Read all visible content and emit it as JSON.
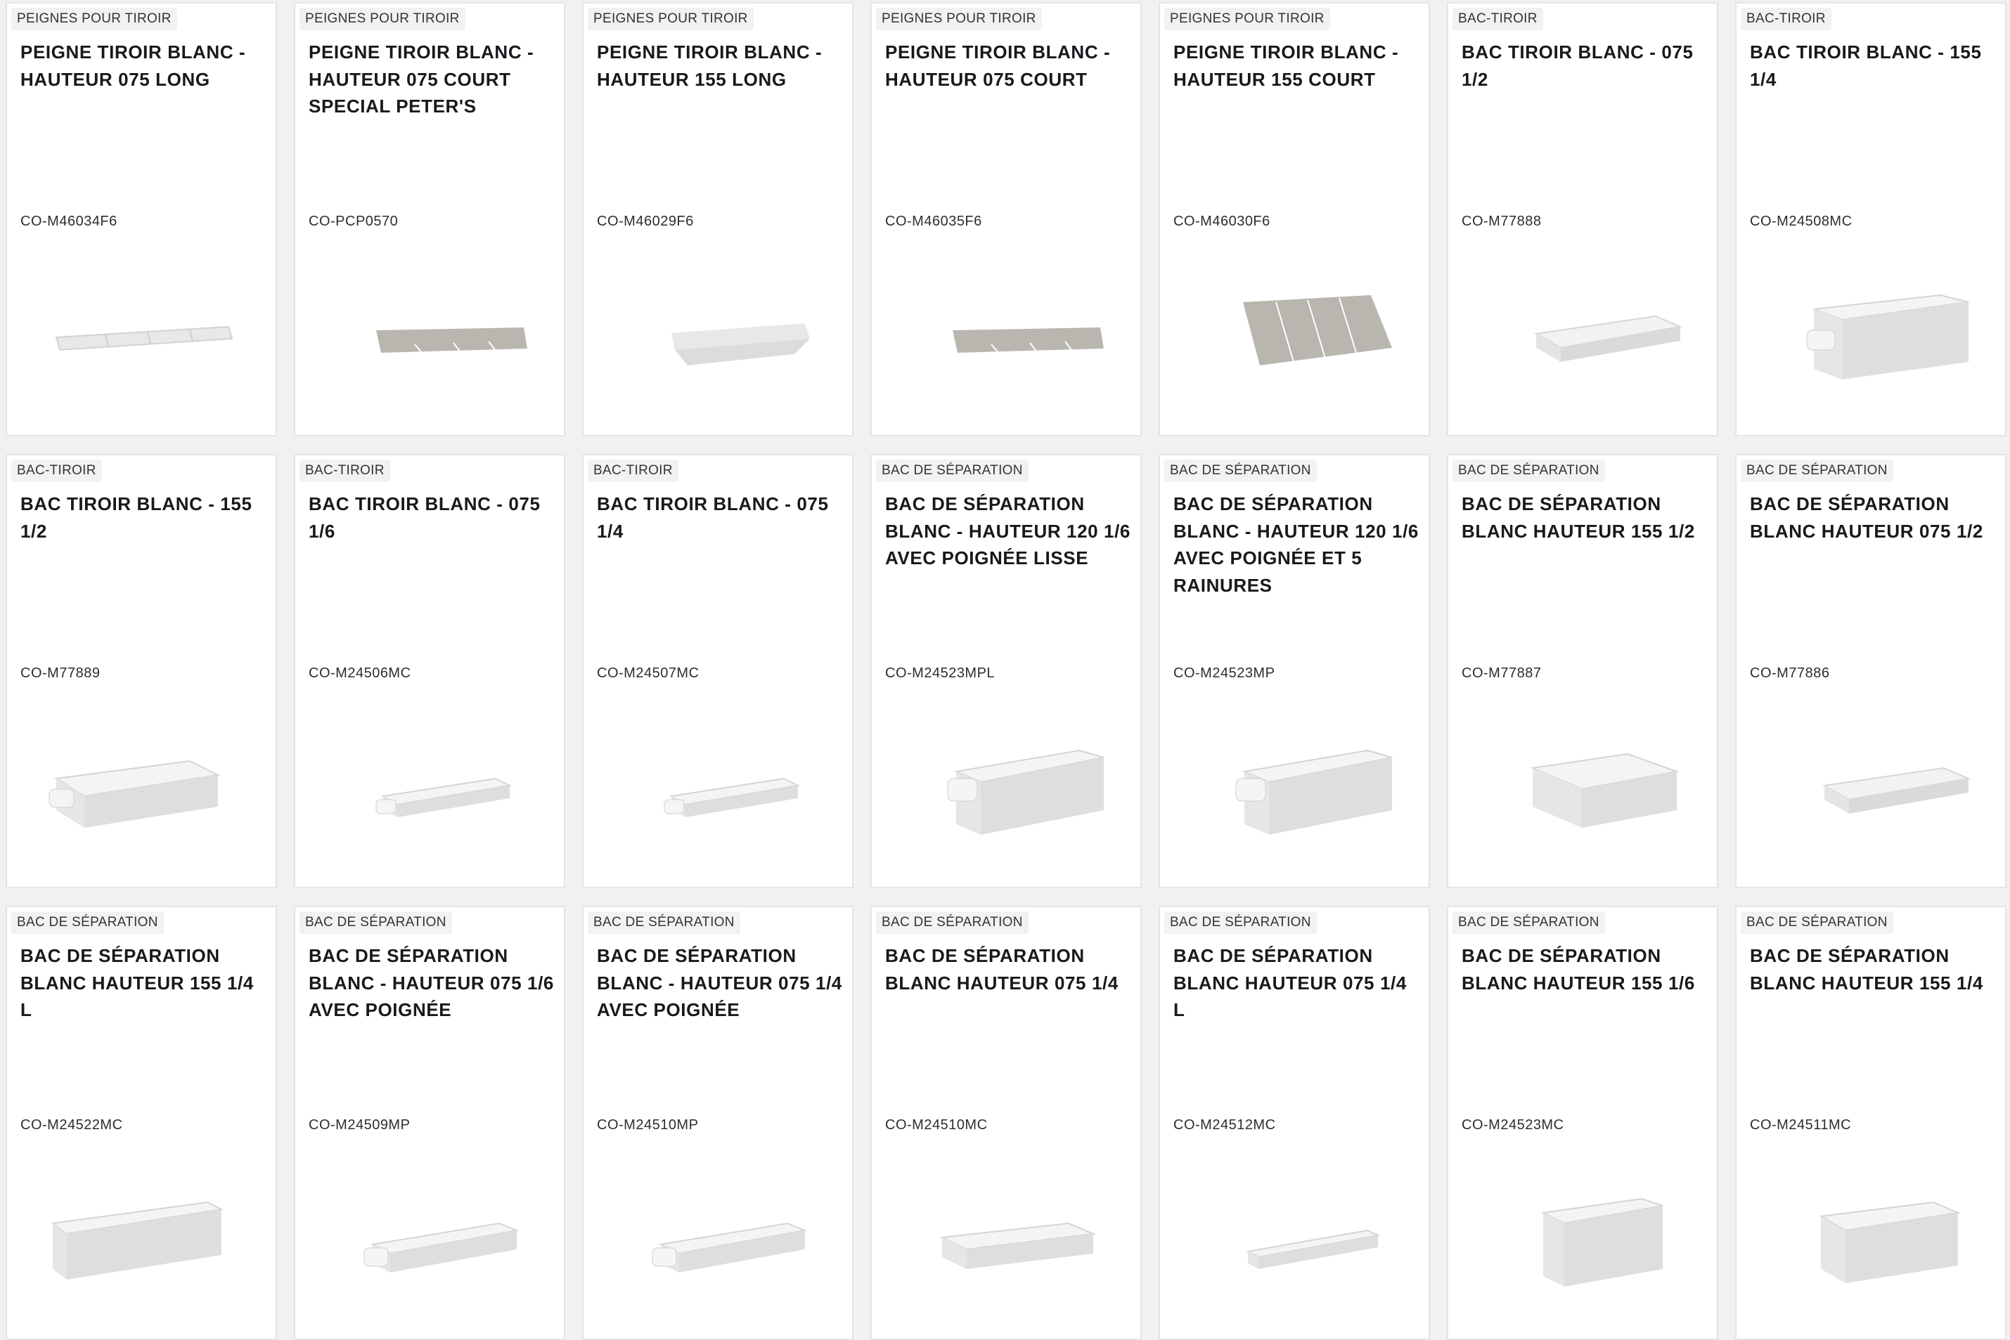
{
  "products": [
    {
      "category": "PEIGNES POUR TIROIR",
      "title": "PEIGNE TIROIR BLANC - HAUTEUR 075 LONG",
      "sku": "CO-M46034F6",
      "image": "comb-long-light"
    },
    {
      "category": "PEIGNES POUR TIROIR",
      "title": "PEIGNE TIROIR BLANC - HAUTEUR 075 COURT SPECIAL PETER'S",
      "sku": "CO-PCP0570",
      "image": "comb-short-grey"
    },
    {
      "category": "PEIGNES POUR TIROIR",
      "title": "PEIGNE TIROIR BLANC - HAUTEUR 155 LONG",
      "sku": "CO-M46029F6",
      "image": "comb-long-light-tilted"
    },
    {
      "category": "PEIGNES POUR TIROIR",
      "title": "PEIGNE TIROIR BLANC - HAUTEUR 075 COURT",
      "sku": "CO-M46035F6",
      "image": "comb-short-grey"
    },
    {
      "category": "PEIGNES POUR TIROIR",
      "title": "PEIGNE TIROIR BLANC - HAUTEUR 155 COURT",
      "sku": "CO-M46030F6",
      "image": "comb-tall-grey"
    },
    {
      "category": "BAC-TIROIR",
      "title": "BAC TIROIR BLANC - 075 1/2",
      "sku": "CO-M77888",
      "image": "tray-shallow"
    },
    {
      "category": "BAC-TIROIR",
      "title": "BAC TIROIR BLANC - 155 1/4",
      "sku": "CO-M24508MC",
      "image": "bin-deep-handle"
    },
    {
      "category": "BAC-TIROIR",
      "title": "BAC TIROIR BLANC - 155 1/2",
      "sku": "CO-M77889",
      "image": "bin-wide-handle"
    },
    {
      "category": "BAC-TIROIR",
      "title": "BAC TIROIR BLANC - 075 1/6",
      "sku": "CO-M24506MC",
      "image": "bin-narrow-low"
    },
    {
      "category": "BAC-TIROIR",
      "title": "BAC TIROIR BLANC - 075 1/4",
      "sku": "CO-M24507MC",
      "image": "bin-narrow-low"
    },
    {
      "category": "BAC DE SÉPARATION",
      "title": "BAC DE SÉPARATION BLANC - HAUTEUR 120 1/6 AVEC POIGNÉE LISSE",
      "sku": "CO-M24523MPL",
      "image": "bin-tall-handle"
    },
    {
      "category": "BAC DE SÉPARATION",
      "title": "BAC DE SÉPARATION BLANC - HAUTEUR 120 1/6 AVEC POIGNÉE ET 5 RAINURES",
      "sku": "CO-M24523MP",
      "image": "bin-tall-handle"
    },
    {
      "category": "BAC DE SÉPARATION",
      "title": "BAC DE SÉPARATION BLANC HAUTEUR 155 1/2",
      "sku": "CO-M77887",
      "image": "bin-wide-deep"
    },
    {
      "category": "BAC DE SÉPARATION",
      "title": "BAC DE SÉPARATION BLANC HAUTEUR 075 1/2",
      "sku": "CO-M77886",
      "image": "tray-shallow"
    },
    {
      "category": "BAC DE SÉPARATION",
      "title": "BAC DE SÉPARATION BLANC HAUTEUR 155 1/4 L",
      "sku": "CO-M24522MC",
      "image": "bin-long-deep"
    },
    {
      "category": "BAC DE SÉPARATION",
      "title": "BAC DE SÉPARATION BLANC - HAUTEUR 075 1/6 AVEC POIGNÉE",
      "sku": "CO-M24509MP",
      "image": "bin-low-handle"
    },
    {
      "category": "BAC DE SÉPARATION",
      "title": "BAC DE SÉPARATION BLANC - HAUTEUR 075 1/4 AVEC POIGNÉE",
      "sku": "CO-M24510MP",
      "image": "bin-low-handle"
    },
    {
      "category": "BAC DE SÉPARATION",
      "title": "BAC DE SÉPARATION BLANC HAUTEUR 075 1/4",
      "sku": "CO-M24510MC",
      "image": "bin-low-ribbed"
    },
    {
      "category": "BAC DE SÉPARATION",
      "title": "BAC DE SÉPARATION BLANC HAUTEUR 075 1/4 L",
      "sku": "CO-M24512MC",
      "image": "bin-long-thin"
    },
    {
      "category": "BAC DE SÉPARATION",
      "title": "BAC DE SÉPARATION BLANC HAUTEUR 155 1/6",
      "sku": "CO-M24523MC",
      "image": "bin-tall-narrow"
    },
    {
      "category": "BAC DE SÉPARATION",
      "title": "BAC DE SÉPARATION BLANC HAUTEUR 155 1/4",
      "sku": "CO-M24511MC",
      "image": "bin-tall-wide"
    }
  ],
  "colors": {
    "page_bg": "#f1f1f2",
    "card_bg": "#ffffff",
    "card_border": "#e4e4e7",
    "tag_bg": "#f2f2f3",
    "text_dark": "#18181d",
    "product_light": "#e8e8ea",
    "product_grey": "#b9b6b0"
  }
}
